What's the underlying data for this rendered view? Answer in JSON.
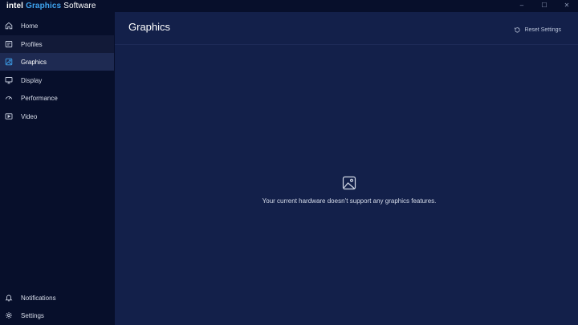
{
  "app": {
    "brand_intel": "intel",
    "brand_graphics": "Graphics",
    "brand_software": "Software"
  },
  "window_controls": {
    "minimize": "–",
    "maximize": "☐",
    "close": "✕"
  },
  "sidebar": {
    "items": [
      {
        "label": "Home",
        "icon": "home-icon"
      },
      {
        "label": "Profiles",
        "icon": "profiles-icon"
      },
      {
        "label": "Graphics",
        "icon": "graphics-icon",
        "active": true
      },
      {
        "label": "Display",
        "icon": "display-icon"
      },
      {
        "label": "Performance",
        "icon": "performance-icon"
      },
      {
        "label": "Video",
        "icon": "video-icon"
      }
    ],
    "bottom_items": [
      {
        "label": "Notifications",
        "icon": "bell-icon"
      },
      {
        "label": "Settings",
        "icon": "gear-icon"
      }
    ]
  },
  "main": {
    "title": "Graphics",
    "reset_label": "Reset Settings",
    "empty_message": "Your current hardware doesn’t support any graphics features.",
    "empty_icon": "image-icon"
  },
  "colors": {
    "background": "#070f2b",
    "panel": "#13204a",
    "active_item": "#1e2a52",
    "accent": "#3ea3ef"
  }
}
